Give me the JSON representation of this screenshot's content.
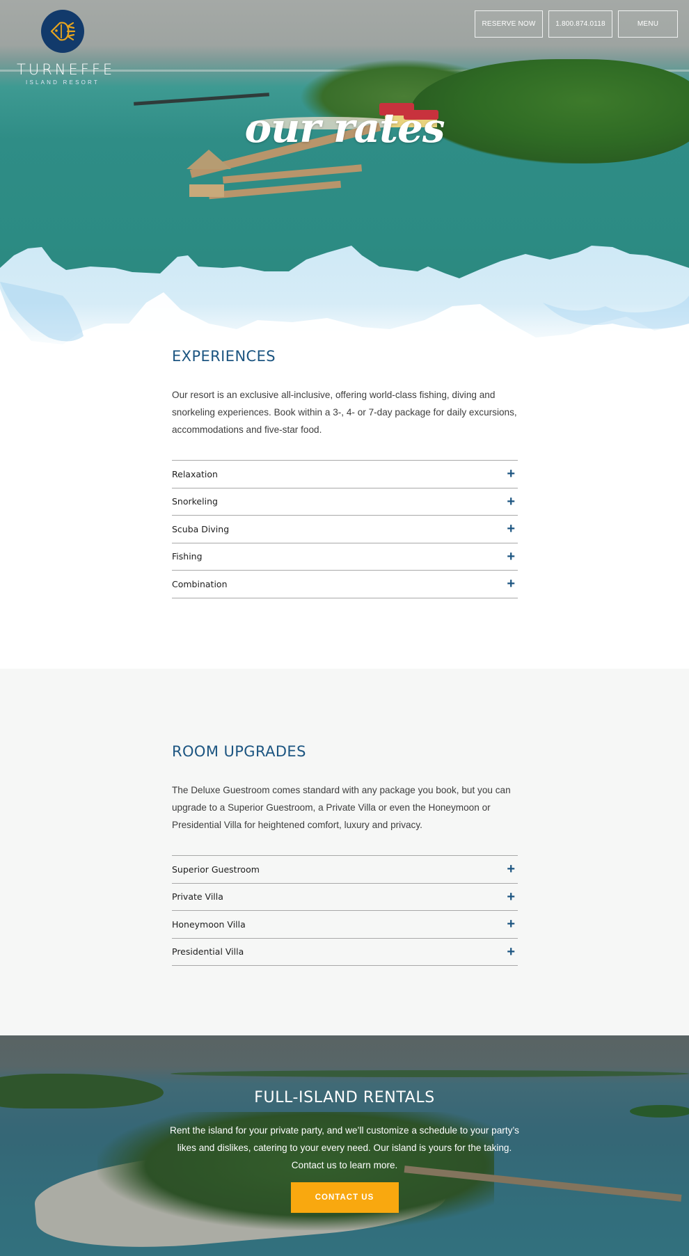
{
  "brand": {
    "name": "TURNEFFE",
    "tagline": "ISLAND RESORT",
    "logo_icon": "fish-icon",
    "colors": {
      "logo_bg": "#123a6b",
      "logo_fish": "#e8a51e",
      "heading": "#1c5581",
      "cta": "#f9a80f",
      "gray_bg": "#f6f7f6"
    }
  },
  "nav": {
    "reserve_label": "RESERVE NOW",
    "phone_label": "1.800.874.0118",
    "menu_label": "MENU"
  },
  "hero": {
    "title": "our rates"
  },
  "experiences": {
    "title": "EXPERIENCES",
    "body": "Our resort is an exclusive all-inclusive, offering world-class fishing, diving and snorkeling experiences. Book within a 3-, 4- or 7-day package for daily excursions, accommodations and five-star food.",
    "items": [
      {
        "label": "Relaxation",
        "icon": "plus-icon"
      },
      {
        "label": "Snorkeling",
        "icon": "plus-icon"
      },
      {
        "label": "Scuba Diving",
        "icon": "plus-icon"
      },
      {
        "label": "Fishing",
        "icon": "plus-icon"
      },
      {
        "label": "Combination",
        "icon": "plus-icon"
      }
    ]
  },
  "upgrades": {
    "title": "ROOM UPGRADES",
    "body": "The Deluxe Guestroom comes standard with any package you book, but you can upgrade to a Superior Guestroom, a Private Villa or even the Honeymoon or Presidential Villa for heightened comfort, luxury and privacy.",
    "items": [
      {
        "label": "Superior Guestroom",
        "icon": "plus-icon"
      },
      {
        "label": "Private Villa",
        "icon": "plus-icon"
      },
      {
        "label": "Honeymoon Villa",
        "icon": "plus-icon"
      },
      {
        "label": "Presidential Villa",
        "icon": "plus-icon"
      }
    ]
  },
  "rentals": {
    "title": "FULL-ISLAND RENTALS",
    "body": "Rent the island for your private party, and we’ll customize a schedule to your party’s likes and dislikes, catering to your every need. Our island is yours for the taking. Contact us to learn more.",
    "cta_label": "CONTACT US"
  },
  "icons": {
    "plus": "+"
  }
}
